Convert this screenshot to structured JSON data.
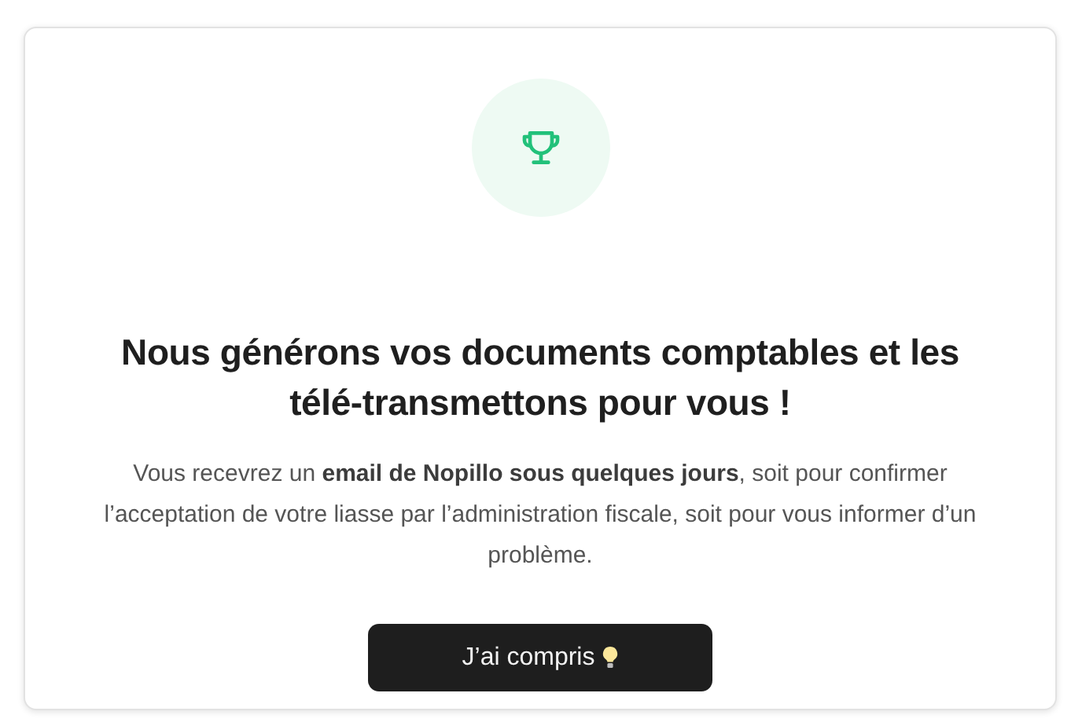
{
  "dialog": {
    "title": "Nous générons vos documents comptables et les télé-transmettons pour vous !",
    "message": "Vous recevrez un **email de Nopillo  sous quelques jours**, soit pour confirmer l’acceptation de votre liasse par l’administration fiscale, soit pour vous informer d’un problème.",
    "button": "J’ai compris"
  }
}
